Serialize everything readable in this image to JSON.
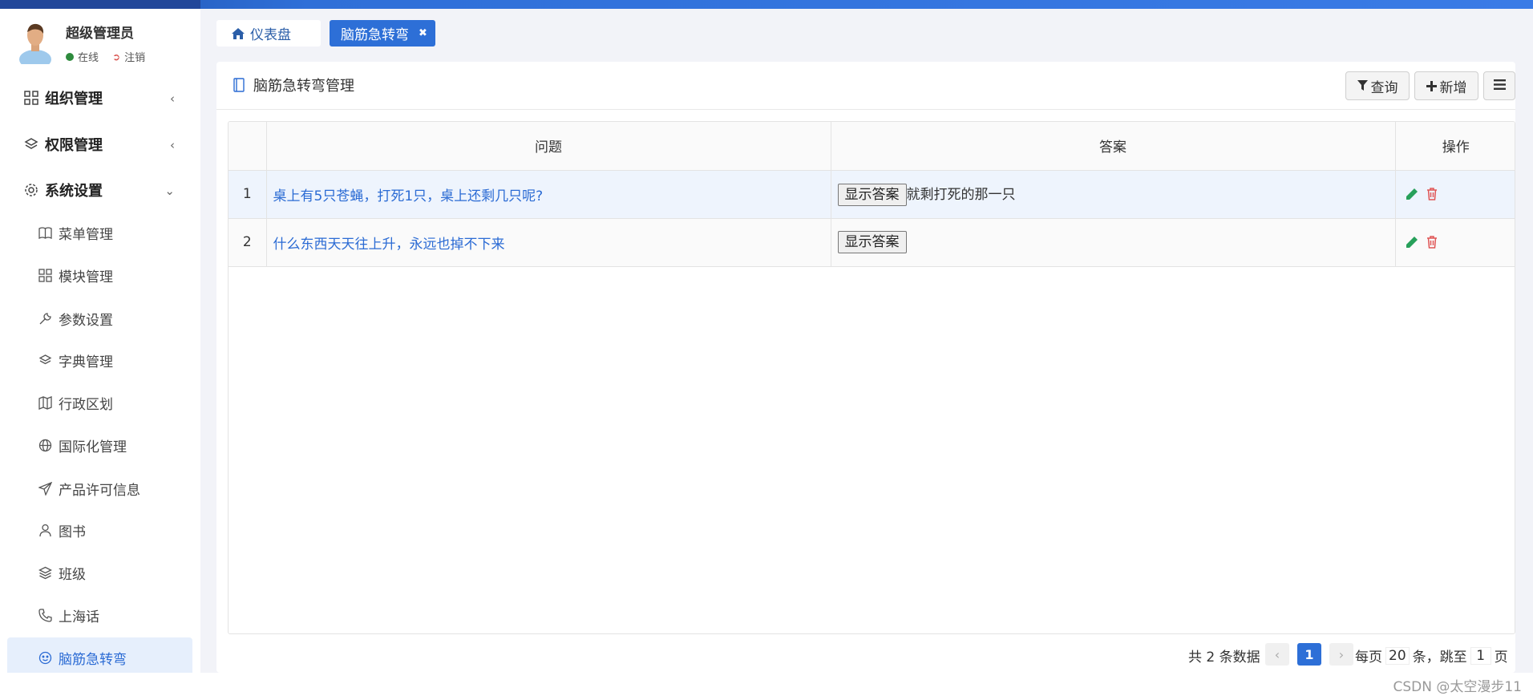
{
  "user": {
    "name": "超级管理员",
    "status": "在线",
    "logout": "注销"
  },
  "sidebar": {
    "groups": [
      {
        "label": "组织管理",
        "icon": "grid-icon"
      },
      {
        "label": "权限管理",
        "icon": "layers-icon"
      },
      {
        "label": "系统设置",
        "icon": "gear-icon"
      }
    ],
    "items": [
      {
        "label": "菜单管理",
        "icon": "book-icon"
      },
      {
        "label": "模块管理",
        "icon": "grid-icon"
      },
      {
        "label": "参数设置",
        "icon": "wrench-icon"
      },
      {
        "label": "字典管理",
        "icon": "layers-icon"
      },
      {
        "label": "行政区划",
        "icon": "map-icon"
      },
      {
        "label": "国际化管理",
        "icon": "globe-icon"
      },
      {
        "label": "产品许可信息",
        "icon": "send-icon"
      },
      {
        "label": "图书",
        "icon": "user-icon"
      },
      {
        "label": "班级",
        "icon": "stack-icon"
      },
      {
        "label": "上海话",
        "icon": "phone-icon"
      },
      {
        "label": "脑筋急转弯",
        "icon": "smile-icon"
      }
    ]
  },
  "tabs": {
    "home": "仪表盘",
    "active": "脑筋急转弯"
  },
  "panel": {
    "title": "脑筋急转弯管理",
    "query_label": "查询",
    "add_label": "新增"
  },
  "table": {
    "headers": {
      "question": "问题",
      "answer": "答案",
      "ops": "操作"
    },
    "show_answer_label": "显示答案",
    "rows": [
      {
        "index": "1",
        "question": "桌上有5只苍蝇，打死1只，桌上还剩几只呢?",
        "answer": "就剩打死的那一只"
      },
      {
        "index": "2",
        "question": "什么东西天天往上升，永远也掉不下来",
        "answer": ""
      }
    ]
  },
  "pagination": {
    "total_prefix": "共",
    "total": "2",
    "total_suffix": "条数据",
    "current_page": "1",
    "per_page_prefix": "每页",
    "per_page": "20",
    "per_page_suffix": "条，跳至",
    "jump_page": "1",
    "page_suffix": "页"
  },
  "watermark": "CSDN @太空漫步11",
  "colors": {
    "primary": "#2d6fd7",
    "link": "#2b6bd4",
    "edit": "#27a05a",
    "delete": "#e05555"
  }
}
